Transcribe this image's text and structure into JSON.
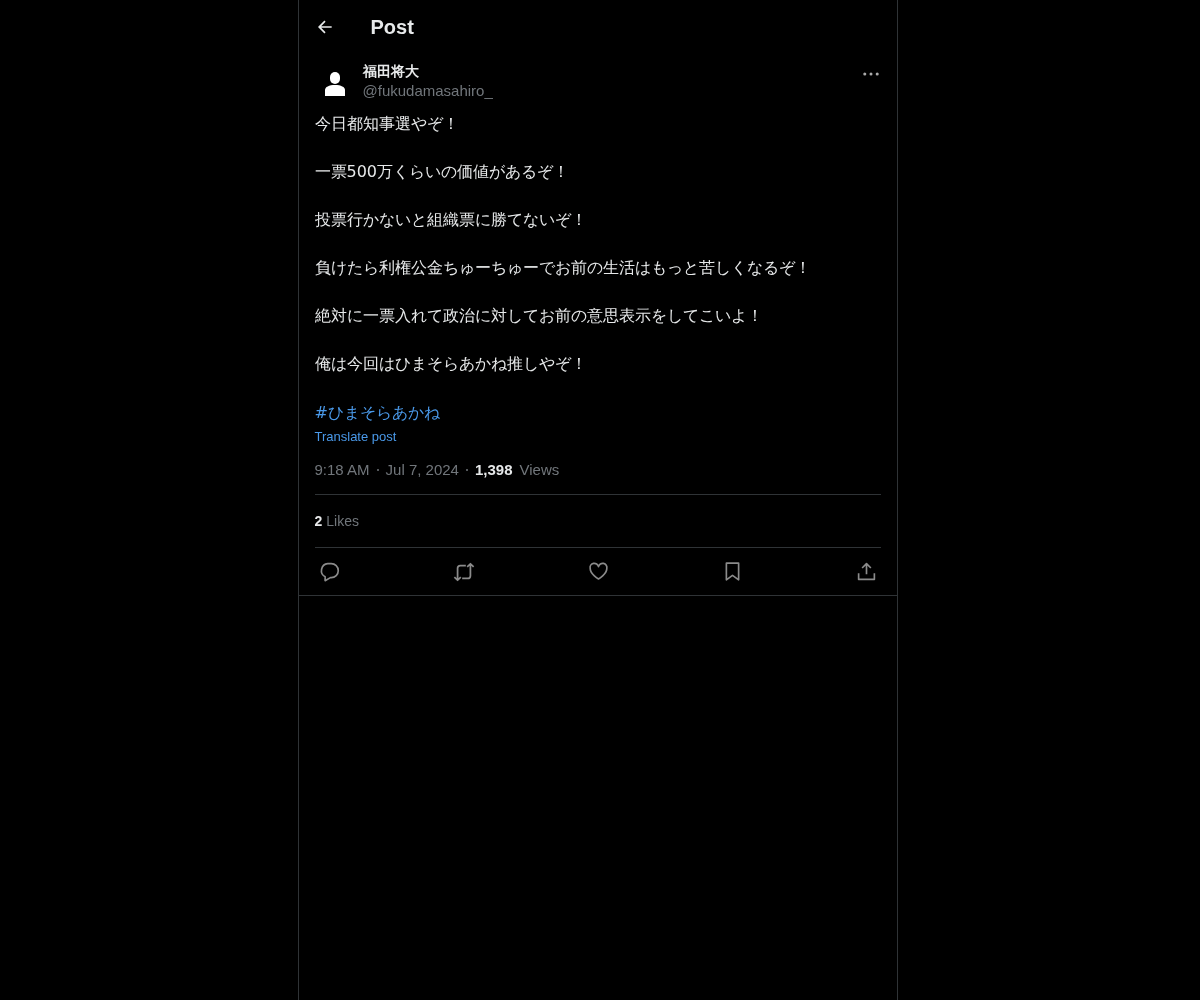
{
  "header": {
    "title": "Post"
  },
  "post": {
    "author": {
      "name": "福田将大",
      "handle": "@fukudamasahiro_"
    },
    "paragraphs": [
      "今日都知事選やぞ！",
      "一票500万くらいの価値があるぞ！",
      "投票行かないと組織票に勝てないぞ！",
      "負けたら利権公金ちゅーちゅーでお前の生活はもっと苦しくなるぞ！",
      "絶対に一票入れて政治に対してお前の意思表示をしてこいよ！",
      "俺は今回はひまそらあかね推しやぞ！"
    ],
    "hashtag": "#ひまそらあかね",
    "translate": "Translate post",
    "time": "9:18 AM",
    "date": "Jul 7, 2024",
    "views_count": "1,398",
    "views_label": "Views",
    "likes_count": "2",
    "likes_label": "Likes",
    "actions": [
      {
        "kind": "reply"
      },
      {
        "kind": "repost"
      },
      {
        "kind": "like"
      },
      {
        "kind": "bookmark"
      },
      {
        "kind": "share"
      }
    ]
  }
}
